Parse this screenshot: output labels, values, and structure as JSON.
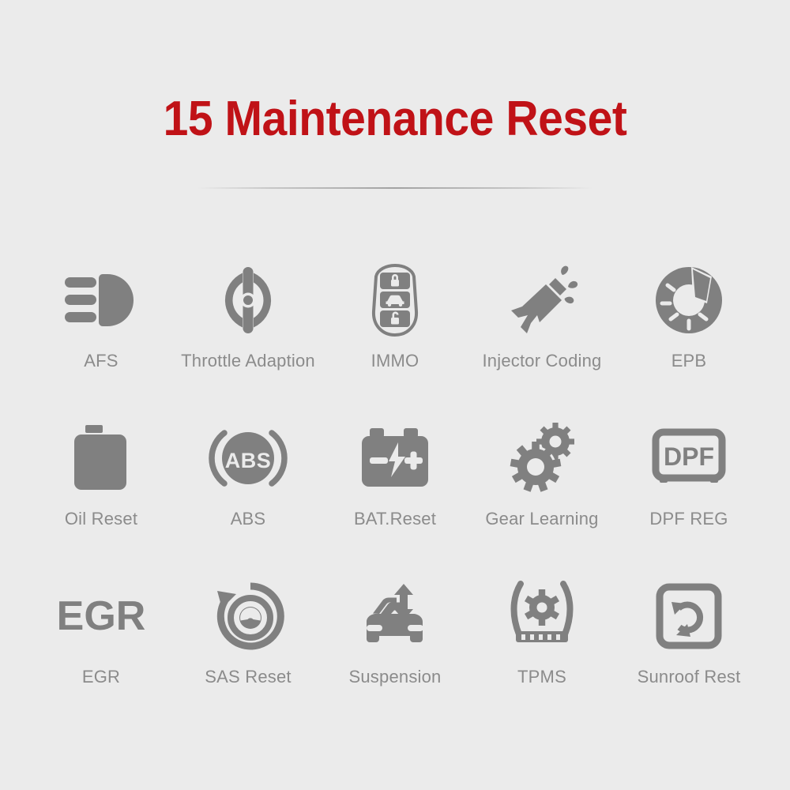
{
  "page": {
    "title": "15 Maintenance Reset",
    "background_color": "#ebebeb",
    "title_color": "#c01217",
    "icon_color": "#808080",
    "label_color": "#8b8b8b"
  },
  "divider": {
    "name": "title-divider"
  },
  "grid": {
    "columns": 5,
    "rows": 3,
    "items": [
      {
        "label": "AFS",
        "icon": "headlamp-afs-icon"
      },
      {
        "label": "Throttle Adaption",
        "icon": "throttle-body-icon"
      },
      {
        "label": "IMMO",
        "icon": "car-key-fob-icon"
      },
      {
        "label": "Injector Coding",
        "icon": "fuel-injector-icon"
      },
      {
        "label": "EPB",
        "icon": "brake-disc-caliper-icon"
      },
      {
        "label": "Oil Reset",
        "icon": "oil-can-icon"
      },
      {
        "label": "ABS",
        "icon": "abs-warning-icon",
        "icon_text": "ABS"
      },
      {
        "label": "BAT.Reset",
        "icon": "car-battery-icon"
      },
      {
        "label": "Gear Learning",
        "icon": "two-gears-icon"
      },
      {
        "label": "DPF REG",
        "icon": "dpf-filter-icon",
        "icon_text": "DPF"
      },
      {
        "label": "EGR",
        "icon": "egr-text-icon",
        "icon_text": "EGR"
      },
      {
        "label": "SAS Reset",
        "icon": "steering-angle-reset-icon"
      },
      {
        "label": "Suspension",
        "icon": "car-suspension-icon"
      },
      {
        "label": "TPMS",
        "icon": "tire-pressure-gear-icon"
      },
      {
        "label": "Sunroof Rest",
        "icon": "sunroof-reset-icon"
      }
    ]
  }
}
